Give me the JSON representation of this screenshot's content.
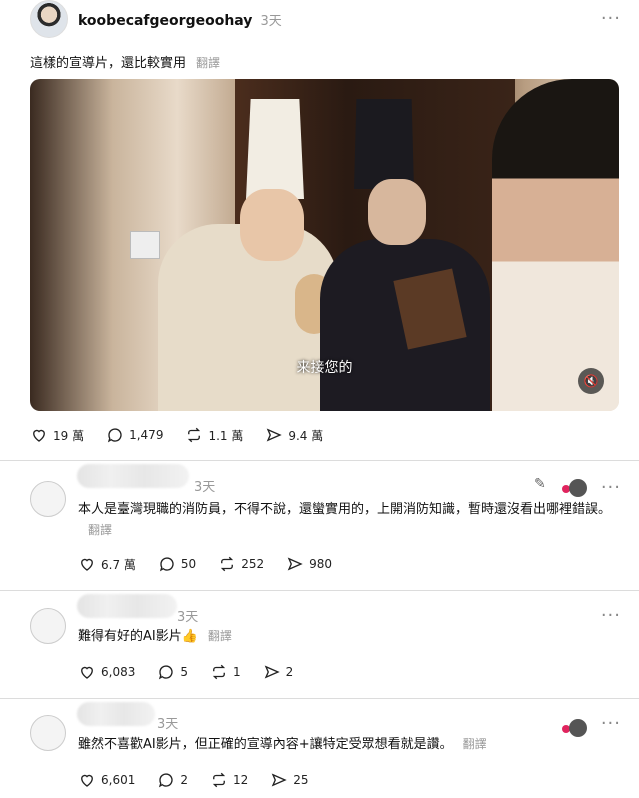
{
  "post": {
    "username": "koobecafgeorgeoohay",
    "time": "3天",
    "text": "這樣的宣導片，還比較實用",
    "translate": "翻譯",
    "video_subtitle": "来接您的",
    "likes": "19 萬",
    "comments": "1,479",
    "reposts": "1.1 萬",
    "shares": "9.4 萬"
  },
  "comments": [
    {
      "time": "3天",
      "text": "本人是臺灣現職的消防員，不得不說，還蠻實用的，上開消防知識，暫時還沒看出哪裡錯誤。",
      "translate": "翻譯",
      "likes": "6.7 萬",
      "replies": "50",
      "reposts": "252",
      "shares": "980"
    },
    {
      "time": "3天",
      "text": "難得有好的AI影片",
      "emoji": "👍",
      "translate": "翻譯",
      "likes": "6,083",
      "replies": "5",
      "reposts": "1",
      "shares": "2"
    },
    {
      "time": "3天",
      "text": "雖然不喜歡AI影片，但正確的宣導內容+讓特定受眾想看就是讚。",
      "translate": "翻譯",
      "likes": "6,601",
      "replies": "2",
      "reposts": "12",
      "shares": "25"
    }
  ],
  "icons": {
    "like": "heart-icon",
    "comment": "speech-bubble-icon",
    "repost": "repost-icon",
    "share": "send-icon",
    "more": "more-horizontal-icon",
    "mute": "speaker-muted-icon",
    "edit": "pencil-icon"
  },
  "more_glyph": "···",
  "mute_glyph": "🔇"
}
